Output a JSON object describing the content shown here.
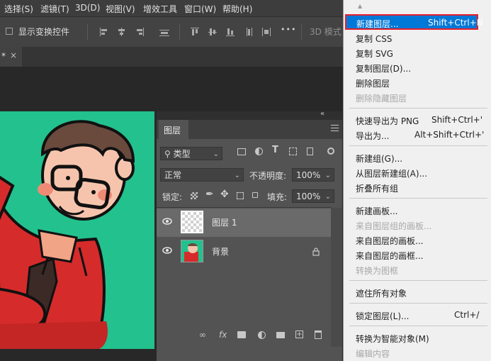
{
  "menubar": {
    "items": [
      "选择(S)",
      "滤镜(T)",
      "3D(D)",
      "视图(V)",
      "增效工具",
      "窗口(W)",
      "帮助(H)"
    ]
  },
  "options": {
    "transform_controls_label": "显示变换控件",
    "more_label": "•••",
    "mode3d_label": "3D 模式"
  },
  "doc_tab": {
    "label": "*",
    "close": "×"
  },
  "layers_panel": {
    "collapse_label": "«",
    "tab_label": "图层",
    "filter_label": "类型",
    "blend_mode": "正常",
    "opacity_label": "不透明度:",
    "opacity_value": "100%",
    "lock_label": "锁定:",
    "fill_label": "填充:",
    "fill_value": "100%",
    "layers": [
      {
        "name": "图层 1",
        "selected": true
      },
      {
        "name": "背景",
        "locked": true
      }
    ],
    "fx_label": "fx"
  },
  "context_menu": {
    "scroll_up": "▲",
    "items": [
      {
        "label": "新建图层...",
        "shortcut": "Shift+Ctrl+N",
        "highlighted": true
      },
      {
        "label": "复制 CSS"
      },
      {
        "label": "复制 SVG"
      },
      {
        "label": "复制图层(D)..."
      },
      {
        "label": "删除图层"
      },
      {
        "label": "删除隐藏图层",
        "disabled": true
      },
      {
        "label": "快速导出为 PNG",
        "shortcut": "Shift+Ctrl+'"
      },
      {
        "label": "导出为...",
        "shortcut": "Alt+Shift+Ctrl+'"
      },
      {
        "label": "新建组(G)..."
      },
      {
        "label": "从图层新建组(A)..."
      },
      {
        "label": "折叠所有组"
      },
      {
        "label": "新建画板..."
      },
      {
        "label": "来自图层组的画板...",
        "disabled": true
      },
      {
        "label": "来自图层的画板..."
      },
      {
        "label": "来自图层的画框..."
      },
      {
        "label": "转换为图框",
        "disabled": true
      },
      {
        "label": "遮住所有对象"
      },
      {
        "label": "锁定图层(L)...",
        "shortcut": "Ctrl+/"
      },
      {
        "label": "转换为智能对象(M)"
      },
      {
        "label": "编辑内容",
        "disabled": true
      }
    ]
  },
  "colors": {
    "highlight": "#0078d7",
    "highlight_border": "#e8202a",
    "canvas_bg": "#23c18d",
    "panel_bg": "#535353"
  }
}
